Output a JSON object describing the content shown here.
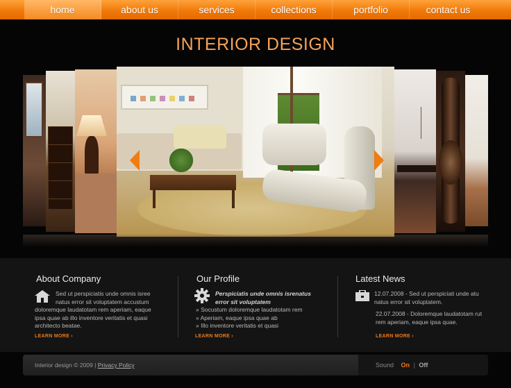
{
  "nav": {
    "items": [
      {
        "label": "home",
        "active": true
      },
      {
        "label": "about us"
      },
      {
        "label": "services"
      },
      {
        "label": "collections"
      },
      {
        "label": "portfolio"
      },
      {
        "label": "contact us"
      }
    ]
  },
  "header": {
    "title": "INTERIOR DESIGN"
  },
  "colors": {
    "accent": "#ef7a1a",
    "nav": "#f07a0a",
    "title": "#f6a35a",
    "background": "#050505"
  },
  "about": {
    "heading": "About Company",
    "lines": [
      "Sed ut perspiciatis unde omnis isree",
      "natus error sit voluptatem accustum",
      "doloremque laudatotam rem aperiam, eaque",
      "ipsa quae ab illo inventore veritatis et quasi",
      "architecto beatae."
    ],
    "more": "LEARN MORE ›",
    "icon": "house-icon"
  },
  "profile": {
    "heading": "Our Profile",
    "intro_lines": [
      "Perspiciatis unde omnis isrenatus",
      "error sit voluptatem"
    ],
    "bullets": [
      "» Socustum doloremque laudatotam rem",
      "» Aperiam, eaque ipsa quae ab",
      "» Illo inventore veritatis et quasi"
    ],
    "more": "LEARN MORE ›",
    "icon": "gear-icon"
  },
  "news": {
    "heading": "Latest News",
    "items": [
      {
        "line1": "12.07.2008 - Sed ut perspiciati unde atu",
        "line2": "natus error sit voluptatem."
      },
      {
        "line1": "22.07.2008 - Doloremque laudatotam rut",
        "line2": "rem aperiam, eaque ipsa quae."
      }
    ],
    "more": "LEARN MORE ›",
    "icon": "briefcase-icon"
  },
  "footer": {
    "copyright": "Interior design © 2009 |",
    "privacy": "Privacy Policy",
    "sound_label": "Sound",
    "on": "On",
    "separator": "|",
    "off": "Off"
  }
}
